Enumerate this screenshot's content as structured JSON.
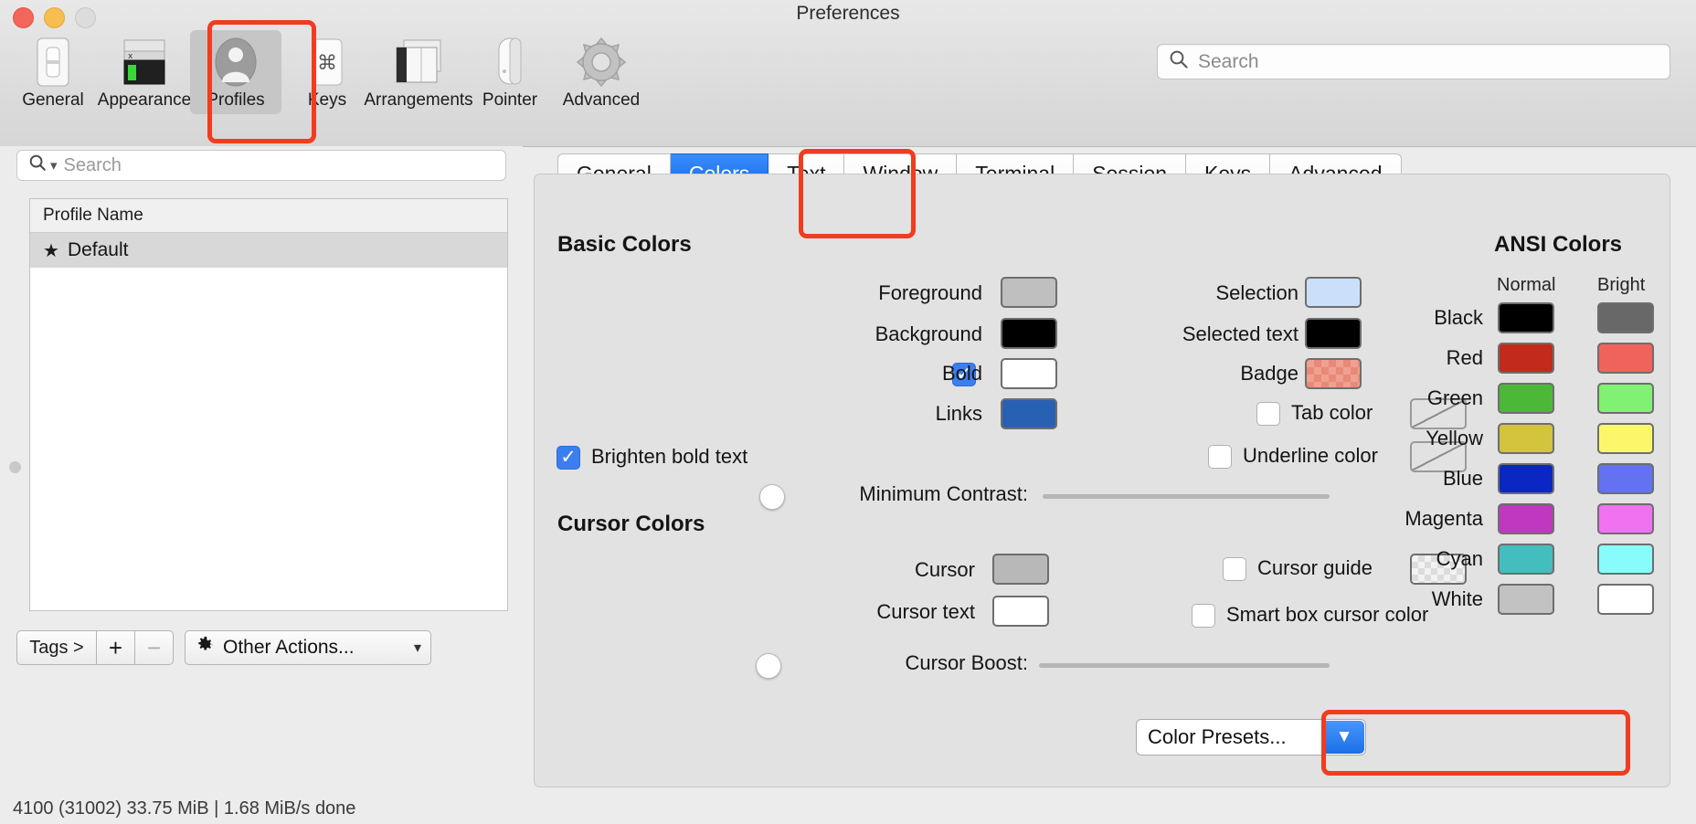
{
  "window": {
    "title": "Preferences",
    "traffic_lights": [
      "close",
      "minimize",
      "zoom"
    ]
  },
  "toolbar": {
    "items": [
      {
        "label": "General",
        "icon": "general-icon",
        "selected": false
      },
      {
        "label": "Appearance",
        "icon": "appearance-icon",
        "selected": false
      },
      {
        "label": "Profiles",
        "icon": "profiles-icon",
        "selected": true
      },
      {
        "label": "Keys",
        "icon": "keys-icon",
        "selected": false
      },
      {
        "label": "Arrangements",
        "icon": "arrangements-icon",
        "selected": false
      },
      {
        "label": "Pointer",
        "icon": "pointer-icon",
        "selected": false
      },
      {
        "label": "Advanced",
        "icon": "advanced-icon",
        "selected": false
      }
    ],
    "search_placeholder": "Search"
  },
  "sidebar": {
    "search_placeholder": "Search",
    "table": {
      "column_header": "Profile Name",
      "rows": [
        {
          "name": "Default",
          "starred": true,
          "selected": true
        }
      ]
    },
    "footer": {
      "tags_label": "Tags >",
      "add_label": "+",
      "remove_label": "−",
      "other_actions_label": "Other Actions...",
      "other_actions_icon": "gear-icon",
      "chevron": "⌄"
    },
    "status_strip": "4100 (31002)   33.75 MiB  |  1.68 MiB/s   done"
  },
  "tabs": [
    {
      "label": "General",
      "active": false
    },
    {
      "label": "Colors",
      "active": true
    },
    {
      "label": "Text",
      "active": false
    },
    {
      "label": "Window",
      "active": false
    },
    {
      "label": "Terminal",
      "active": false
    },
    {
      "label": "Session",
      "active": false
    },
    {
      "label": "Keys",
      "active": false
    },
    {
      "label": "Advanced",
      "active": false
    }
  ],
  "colors_panel": {
    "basic_colors": {
      "title": "Basic Colors",
      "left_rows": [
        {
          "label": "Foreground",
          "color": "#bfbfbf",
          "kind": "solid"
        },
        {
          "label": "Background",
          "color": "#000000",
          "kind": "solid"
        },
        {
          "label": "Bold",
          "color": "#ffffff",
          "kind": "solid",
          "checkbox": true,
          "checked": true
        },
        {
          "label": "Links",
          "color": "#2860b4",
          "kind": "solid"
        }
      ],
      "right_rows": [
        {
          "label": "Selection",
          "color": "#cbdffb",
          "kind": "solid"
        },
        {
          "label": "Selected text",
          "color": "#000000",
          "kind": "solid"
        },
        {
          "label": "Badge",
          "color": "#f0a090",
          "kind": "checker-badge"
        },
        {
          "label": "Tab color",
          "color": "",
          "kind": "none",
          "checkbox": true,
          "checked": false
        },
        {
          "label": "Underline color",
          "color": "",
          "kind": "none",
          "checkbox": true,
          "checked": false
        }
      ],
      "brighten_bold_text": {
        "label": "Brighten bold text",
        "checked": true
      },
      "minimum_contrast": {
        "label": "Minimum Contrast:",
        "value": 0
      }
    },
    "cursor_colors": {
      "title": "Cursor Colors",
      "rows": [
        {
          "label": "Cursor",
          "color": "#b8b8b8",
          "kind": "solid"
        },
        {
          "label": "Cursor text",
          "color": "#ffffff",
          "kind": "solid"
        }
      ],
      "cursor_guide": {
        "label": "Cursor guide",
        "checked": false,
        "swatch_kind": "checker-clear"
      },
      "smart_box_cursor_color": {
        "label": "Smart box cursor color",
        "checked": false
      },
      "cursor_boost": {
        "label": "Cursor Boost:",
        "value": 0
      }
    },
    "ansi_colors": {
      "title": "ANSI Colors",
      "columns": [
        "Normal",
        "Bright"
      ],
      "rows": [
        {
          "name": "Black",
          "normal": "#000000",
          "bright": "#686868"
        },
        {
          "name": "Red",
          "normal": "#c22a1c",
          "bright": "#f0635c"
        },
        {
          "name": "Green",
          "normal": "#4cb838",
          "bright": "#80f173"
        },
        {
          "name": "Yellow",
          "normal": "#d3c33d",
          "bright": "#fbf76a"
        },
        {
          "name": "Blue",
          "normal": "#0a27c4",
          "bright": "#6272f0"
        },
        {
          "name": "Magenta",
          "normal": "#bf38bf",
          "bright": "#f072f0"
        },
        {
          "name": "Cyan",
          "normal": "#43bdbd",
          "bright": "#88fbfb"
        },
        {
          "name": "White",
          "normal": "#c2c2c2",
          "bright": "#ffffff"
        }
      ]
    },
    "color_presets": {
      "label": "Color Presets...",
      "chevron": "⌄"
    }
  },
  "annotations": {
    "accent_color": "#f03c20",
    "highlighted": [
      "toolbar-item-profiles",
      "tab-colors",
      "color-presets-dropdown"
    ]
  }
}
